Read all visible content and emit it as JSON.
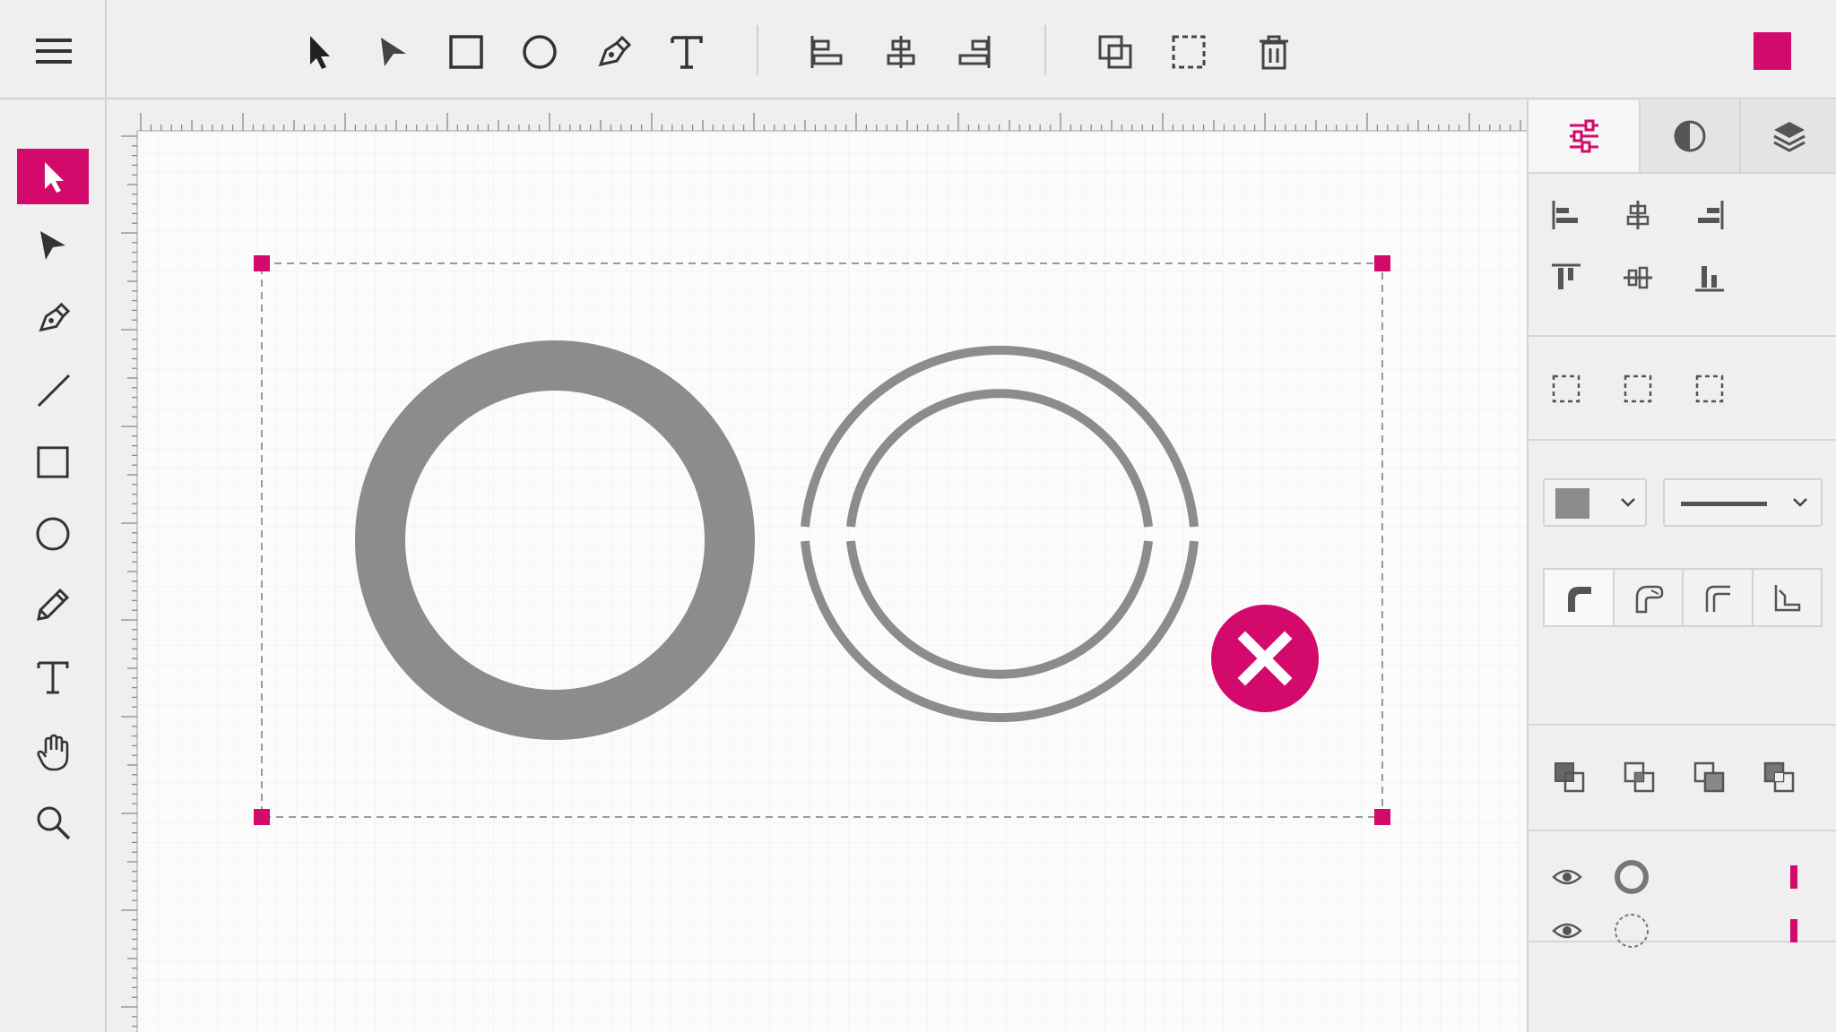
{
  "colors": {
    "accent": "#d3096c",
    "icon": "#333333",
    "shape_gray": "#8c8c8c",
    "bg": "#efefef",
    "canvas": "#fbfbfb"
  },
  "topbar": {
    "menu_icon": "hamburger-menu-icon",
    "tools": [
      "select-arrow-icon",
      "direct-select-icon",
      "rectangle-icon",
      "ellipse-icon",
      "pen-icon",
      "text-icon"
    ],
    "align": [
      "align-left-icon",
      "align-center-icon",
      "align-right-icon"
    ],
    "actions": [
      "duplicate-icon",
      "marquee-select-icon",
      "trash-icon"
    ],
    "current_color": "#d3096c"
  },
  "left_toolbar": {
    "active_tool": "select",
    "tools": [
      "select",
      "direct-select",
      "pen",
      "line",
      "rectangle",
      "ellipse",
      "pencil",
      "text",
      "hand",
      "zoom"
    ]
  },
  "canvas": {
    "selection_color": "#d3096c",
    "shapes": [
      {
        "name": "thick-ring",
        "fill": "#8c8c8c"
      },
      {
        "name": "double-ring",
        "stroke": "#8c8c8c",
        "badge": "close-icon"
      }
    ]
  },
  "panel": {
    "tabs": [
      "properties-sliders-icon",
      "appearance-contrast-icon",
      "layers-stack-icon"
    ],
    "active_tab": 0,
    "fill_color": "#8c8c8c",
    "layers": [
      {
        "thumb": "ring-thumbnail",
        "visible": true
      },
      {
        "thumb": "dashed-circle-thumbnail",
        "visible": true
      }
    ]
  }
}
